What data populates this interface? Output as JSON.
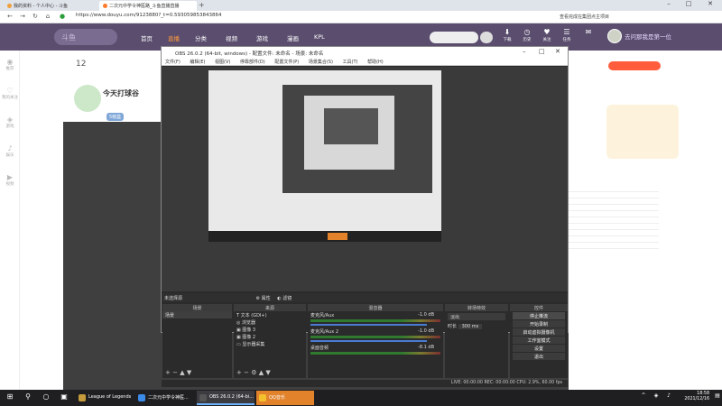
{
  "browser": {
    "tabs": [
      {
        "label": "我的资料 - 个人中心 - 斗鱼",
        "active": false,
        "color": "#f0a03c"
      },
      {
        "label": "二次元中学令神医路_斗鱼直播直播",
        "active": true,
        "color": "#ff7a2c"
      }
    ],
    "new_tab_glyph": "+",
    "url": "https://www.douyu.com/9123880?_t=0.593059853843864",
    "bar_hint": "查看完成在集团点主项目"
  },
  "site": {
    "logo_text": "斗鱼",
    "nav": [
      "首页",
      "直播",
      "分类",
      "视频",
      "游戏",
      "漫画",
      "KPL"
    ],
    "active_nav": "直播",
    "header_icons": [
      "下载",
      "历史",
      "关注",
      "任务"
    ],
    "user_name": "去问那我是第一位"
  },
  "sidebar": [
    "推荐",
    "我的关注",
    "游戏",
    "娱乐",
    "视频"
  ],
  "stream": {
    "online_count": "12",
    "room_title": "今天打球谷",
    "level_badge": "5级篮"
  },
  "obs": {
    "title": "OBS 26.0.2 (64-bit, windows) - 配置文件: 未命名 - 场景: 未命名",
    "menu": [
      "文件(F)",
      "编辑(E)",
      "视图(V)",
      "停靠部件(D)",
      "配置文件(P)",
      "场景集合(S)",
      "工具(T)",
      "帮助(H)"
    ],
    "source_bar_label": "未选择源",
    "scenes_header": "场景",
    "scenes": [
      "场景"
    ],
    "sources_header": "来源",
    "sources": [
      "文本 (GDI+)",
      "浏览器",
      "图像 3",
      "图像 2",
      "显示器采集"
    ],
    "mixer_header": "混音器",
    "mixer": [
      {
        "name": "麦克风/Aux",
        "db": "-1.0 dB"
      },
      {
        "name": "麦克风/Aux 2",
        "db": "-1.0 dB"
      },
      {
        "name": "桌面音频",
        "db": "-8.1 dB"
      }
    ],
    "transition_header": "转场特效",
    "transition_type": "淡出",
    "duration_label": "时长",
    "duration_value": "300 ms",
    "controls_header": "控件",
    "controls": [
      "停止推流",
      "开始录制",
      "启动虚拟摄像机",
      "工作室模式",
      "设置",
      "退出"
    ],
    "status": "LIVE: 00:00:00   REC: 00:00:00   CPU: 2.9%, 60.00 fps"
  },
  "taskbar": {
    "apps": [
      {
        "label": "League of Legends",
        "color": "#c59b3b"
      },
      {
        "label": "二次元中学令神医...",
        "color": "#3c8ae8"
      },
      {
        "label": "OBS 26.0.2 (64-bi...",
        "color": "#555555",
        "active": true
      },
      {
        "label": "QQ音乐",
        "color": "#f4c02e",
        "music": true
      }
    ],
    "time": "18:58",
    "date": "2021/12/16"
  }
}
